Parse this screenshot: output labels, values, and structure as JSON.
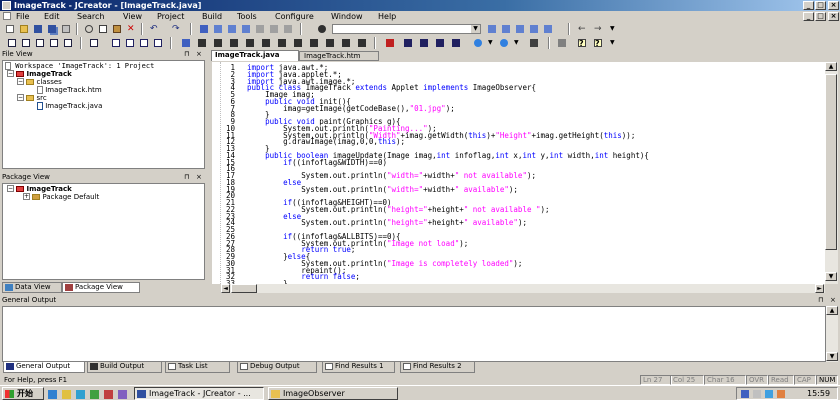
{
  "window": {
    "title": "ImageTrack - JCreator - [ImageTrack.java]"
  },
  "menu": [
    "File",
    "Edit",
    "Search",
    "View",
    "Project",
    "Build",
    "Tools",
    "Configure",
    "Window",
    "Help"
  ],
  "file_view": {
    "title": "File View",
    "workspace": "Workspace 'ImageTrack': 1 Project",
    "project": "ImageTrack",
    "folders": [
      "classes",
      "src"
    ],
    "files": [
      "ImageTrack.htm",
      "ImageTrack.java"
    ]
  },
  "package_view": {
    "title": "Package View",
    "project": "ImageTrack",
    "package": "Package Default"
  },
  "left_tabs": [
    "Data View",
    "Package View"
  ],
  "editor_tabs": [
    "ImageTrack.java",
    "ImageTrack.htm"
  ],
  "code_lines": [
    "import java.awt.*;",
    "import java.applet.*;",
    "import java.awt.image.*;",
    "public class ImageTrack extends Applet implements ImageObserver{",
    "    Image imag;",
    "    public void init(){",
    "        imag=getImage(getCodeBase(),\"01.jpg\");",
    "    }",
    "    public void paint(Graphics g){",
    "        System.out.println(\"Painting...\");",
    "        System.out.println(\"Width\"+imag.getWidth(this)+\"Height\"+imag.getHeight(this));",
    "        g.drawImage(imag,0,0,this);",
    "    }",
    "    public boolean imageUpdate(Image imag,int infoflag,int x,int y,int width,int height){",
    "        if((infoflag&WIDTH)==0)",
    "",
    "            System.out.println(\"width=\"+width+\" not available\");",
    "        else",
    "            System.out.println(\"width=\"+width+\" available\");",
    "",
    "        if((infoflag&HEIGHT)==0)",
    "            System.out.println(\"height=\"+height+\" not available \");",
    "        else",
    "            System.out.println(\"height=\"+height+\" available\");",
    "",
    "        if((infoflag&ALLBITS)==0){",
    "            System.out.println(\"Image not load\");",
    "            return true;",
    "        }else{",
    "            System.out.println(\"Image is completely loaded\");",
    "            repaint();",
    "            return false;",
    "        }"
  ],
  "output": {
    "title": "General Output"
  },
  "bottom_tabs": [
    "General Output",
    "Build Output",
    "Task List",
    "Debug Output",
    "Find Results 1",
    "Find Results 2"
  ],
  "status": {
    "hint": "For Help, press F1",
    "ln": "Ln 27",
    "col": "Col 25",
    "char": "Char 16",
    "ovr": "OVR",
    "read": "Read",
    "cap": "CAP",
    "num": "NUM"
  },
  "taskbar": {
    "start": "开始",
    "tasks": [
      "ImageTrack - JCreator - ...",
      "ImageObserver"
    ],
    "time": "15:59"
  },
  "colors": {
    "keyword": "#0000ff",
    "string": "#ff00ff",
    "title_start": "#0a246a",
    "title_end": "#a6caf0"
  }
}
